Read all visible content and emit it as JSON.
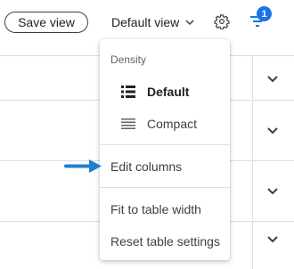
{
  "toolbar": {
    "save_label": "Save view",
    "view_select_label": "Default view",
    "filter_badge": "1"
  },
  "menu": {
    "section_label": "Density",
    "density_options": [
      {
        "label": "Default",
        "selected": true,
        "icon": "list-default-icon"
      },
      {
        "label": "Compact",
        "selected": false,
        "icon": "list-compact-icon"
      }
    ],
    "edit_columns": "Edit columns",
    "fit_to_width": "Fit to table width",
    "reset_settings": "Reset table settings"
  },
  "colors": {
    "accent": "#1a73e8",
    "arrow": "#1e7fd0",
    "text": "#202124",
    "divider": "#e0e0e0"
  }
}
